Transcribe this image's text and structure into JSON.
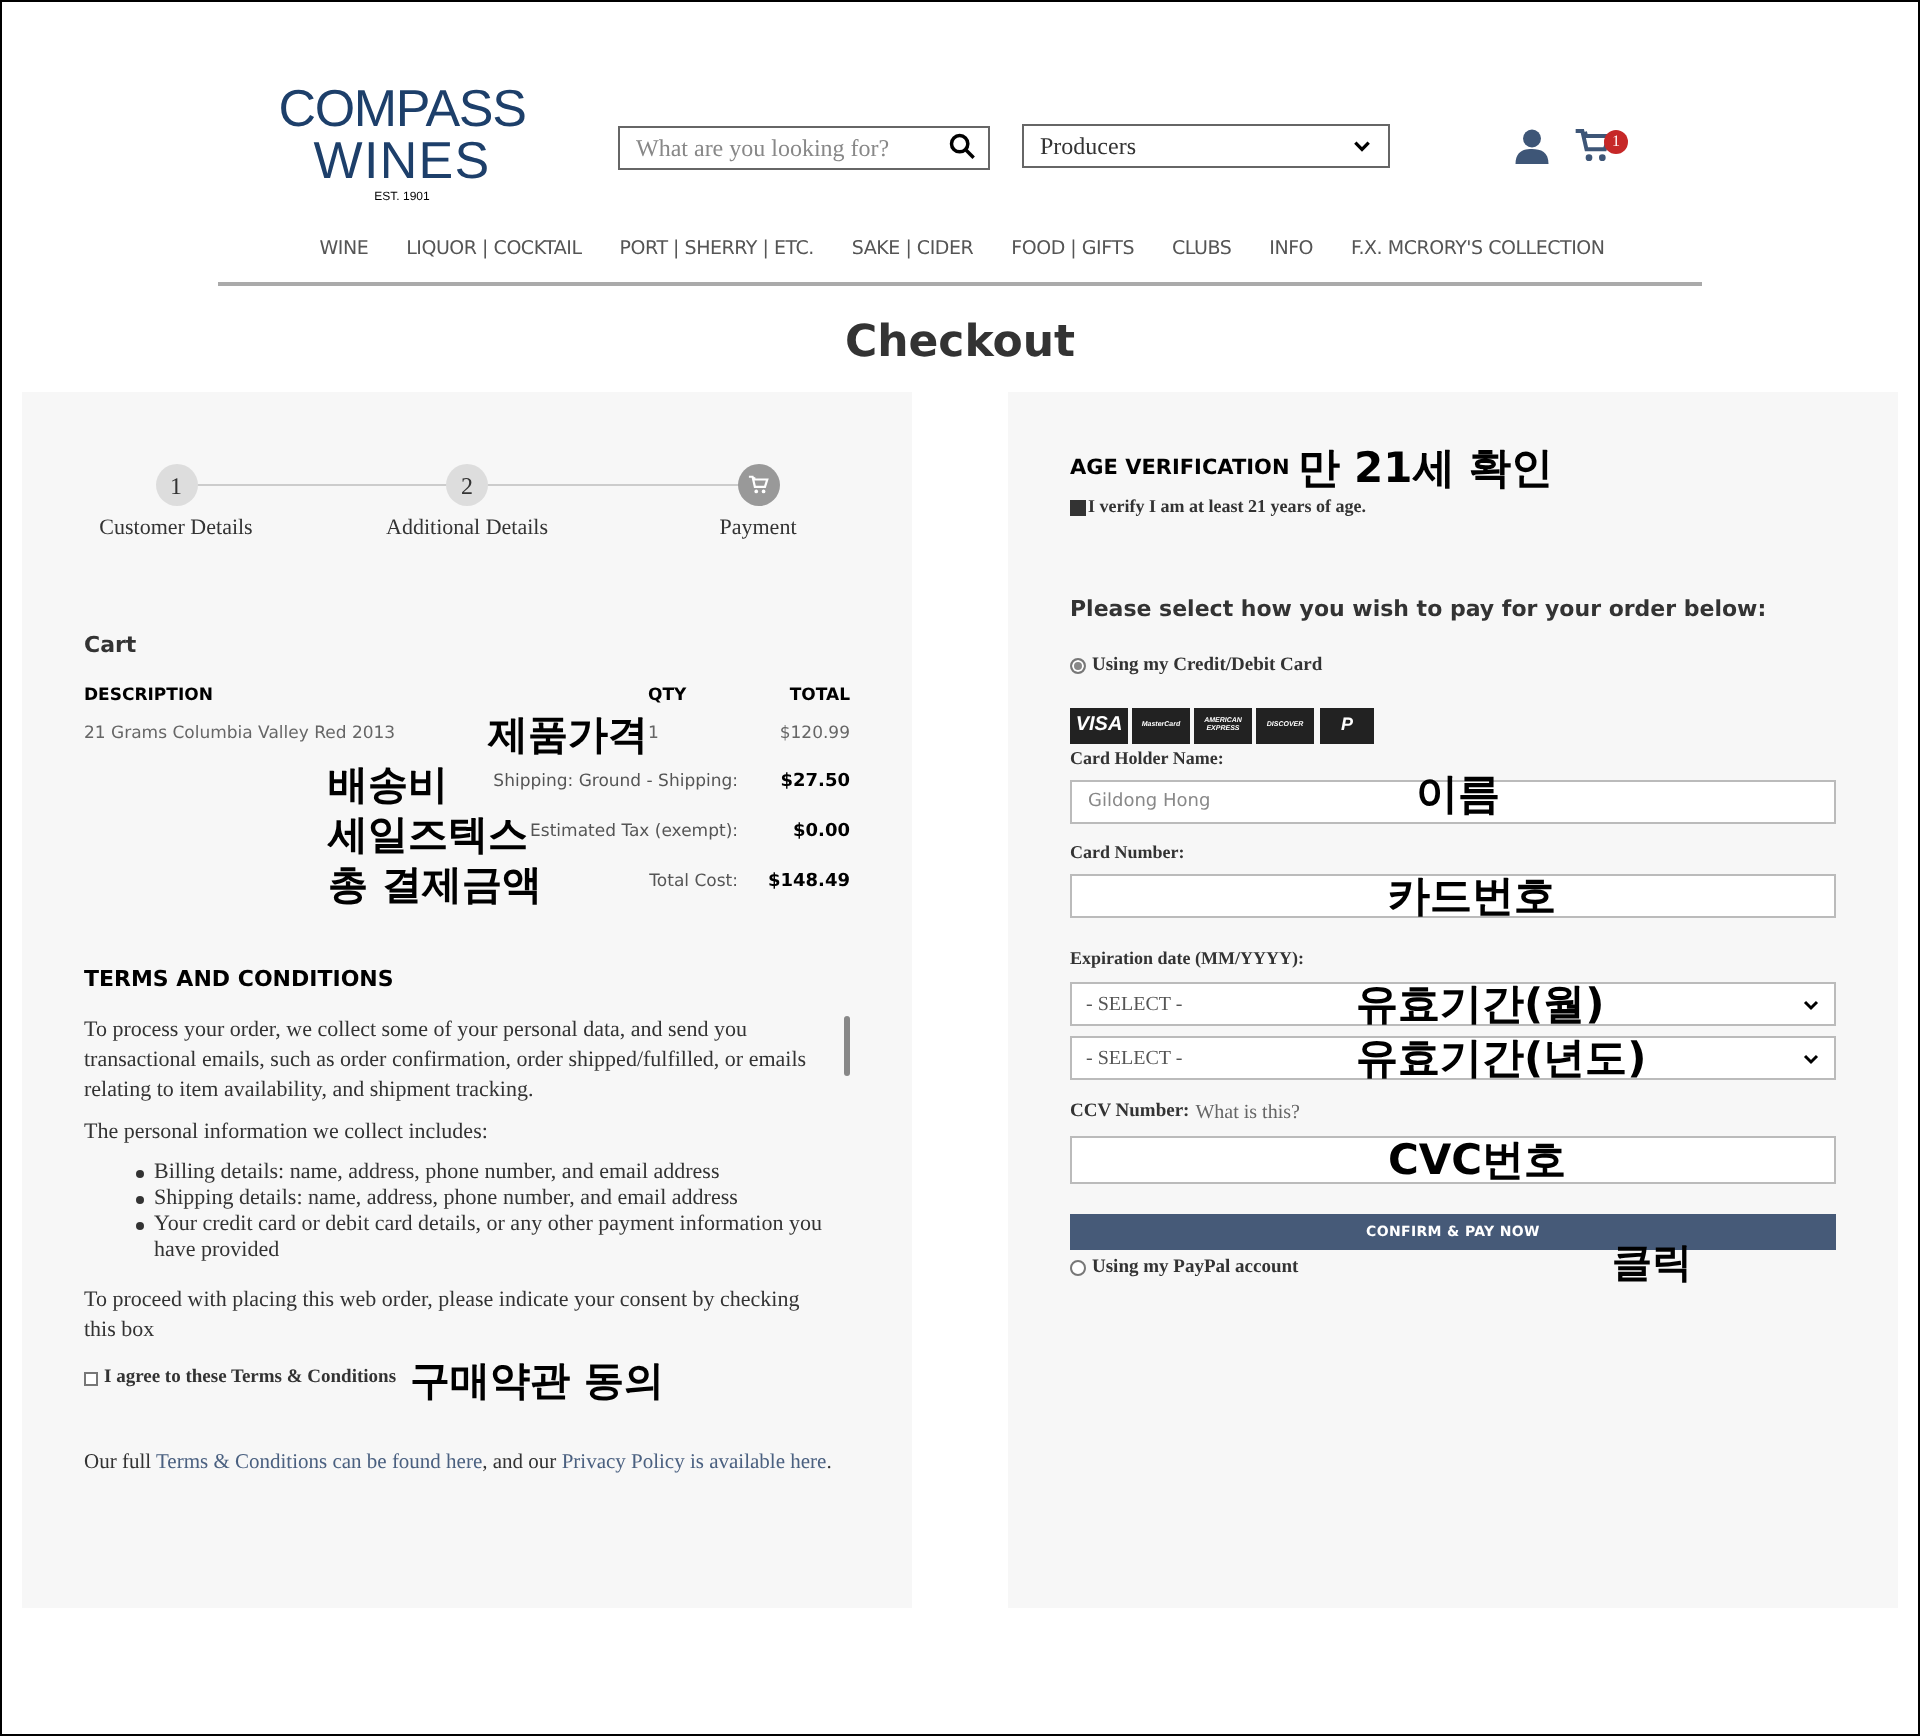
{
  "header": {
    "logo": {
      "line1": "COMPASS",
      "line2": "WINES",
      "tagline": "EST. 1901"
    },
    "search": {
      "placeholder": "What are you looking for?"
    },
    "producers": {
      "value": "Producers"
    },
    "cart_count": "1"
  },
  "nav": [
    "WINE",
    "LIQUOR | COCKTAIL",
    "PORT | SHERRY | ETC.",
    "SAKE | CIDER",
    "FOOD | GIFTS",
    "CLUBS",
    "INFO",
    "F.X. MCRORY'S COLLECTION"
  ],
  "page_title": "Checkout",
  "steps": [
    {
      "kind": "number",
      "number": "1",
      "label": "Customer Details",
      "selected": false
    },
    {
      "kind": "number",
      "number": "2",
      "label": "Additional Details",
      "selected": false
    },
    {
      "kind": "icon",
      "label": "Payment",
      "selected": true
    }
  ],
  "cart": {
    "title": "Cart",
    "columns": [
      "DESCRIPTION",
      "QTY",
      "TOTAL"
    ],
    "items": [
      {
        "description": "21 Grams Columbia Valley Red 2013",
        "annotation": "제품가격",
        "qty": "1",
        "total": "$120.99"
      }
    ],
    "summary": [
      {
        "annotation": "배송비",
        "label": "Shipping: Ground - Shipping:",
        "value": "$27.50"
      },
      {
        "annotation": "세일즈텍스",
        "label": "Estimated Tax (exempt):",
        "value": "$0.00"
      },
      {
        "annotation": "총 결제금액",
        "label": "Total Cost:",
        "value": "$148.49"
      }
    ]
  },
  "terms": {
    "title": "TERMS AND CONDITIONS",
    "paragraphs": [
      "To process your order, we collect some of your personal data, and send you transactional emails, such as order confirmation, order shipped/fulfilled, or emails relating to item availability, and shipment tracking.",
      "The personal information we collect includes:"
    ],
    "bullets": [
      "Billing details: name, address, phone number, and email address",
      "Shipping details: name, address, phone number, and email address",
      "Your credit card or debit card details, or any other payment information you have provided"
    ],
    "consent_text": "To proceed with placing this web order, please indicate your consent by checking this box",
    "agree": {
      "label": "I agree to these Terms & Conditions",
      "checked": false,
      "annotation": "구매약관 동의"
    },
    "footer": {
      "before": "Our full ",
      "link1": "Terms & Conditions can be found here",
      "middle": ", and our ",
      "link2": "Privacy Policy is available here",
      "after": "."
    }
  },
  "age": {
    "title": "AGE VERIFICATION",
    "annotation": "만 21세 확인",
    "label": "I verify I am at least 21 years of age.",
    "checked": true
  },
  "payment": {
    "prompt": "Please select how you wish to pay for your order below:",
    "methods": [
      {
        "label": "Using my Credit/Debit Card",
        "selected": true
      },
      {
        "label": "Using my PayPal account",
        "selected": false
      }
    ],
    "cards": [
      "VISA",
      "MasterCard",
      "AMERICAN EXPRESS",
      "DISCOVER",
      "P"
    ],
    "holder": {
      "label": "Card Holder Name:",
      "placeholder": "Gildong Hong",
      "annotation": "이름"
    },
    "number": {
      "label": "Card Number:",
      "annotation": "카드번호"
    },
    "expiry": {
      "label": "Expiration date (MM/YYYY):",
      "selects": [
        {
          "value": "- SELECT -",
          "annotation": "유효기간(월)"
        },
        {
          "value": "- SELECT -",
          "annotation": "유효기간(년도)"
        }
      ]
    },
    "ccv": {
      "label": "CCV Number:",
      "link": "What is this?",
      "annotation": "CVC번호"
    },
    "button": {
      "label": "CONFIRM & PAY NOW",
      "annotation": "클릭"
    }
  }
}
